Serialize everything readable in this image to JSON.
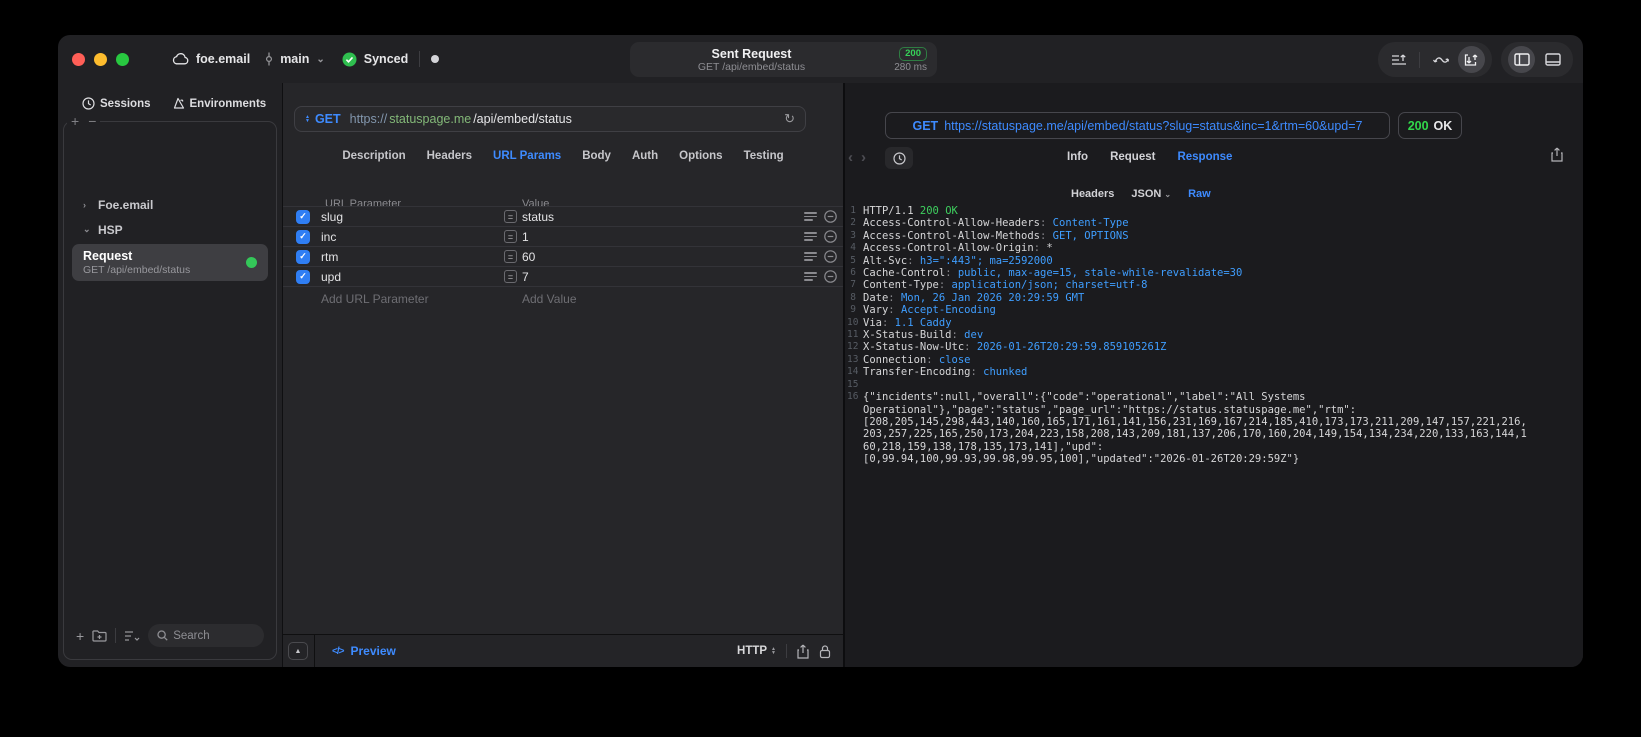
{
  "titlebar": {
    "project": "foe.email",
    "branch": "main",
    "sync_status": "Synced",
    "request_title": "Sent Request",
    "request_subtitle": "GET /api/embed/status",
    "status_code": "200",
    "duration": "280 ms"
  },
  "sidebar": {
    "tabs": [
      {
        "label": "Sessions"
      },
      {
        "label": "Environments"
      }
    ],
    "groups": [
      {
        "label": "Foe.email",
        "chevron": "›"
      },
      {
        "label": "HSP",
        "chevron": "⌄"
      }
    ],
    "request_item": {
      "title": "Request",
      "subtitle": "GET /api/embed/status"
    },
    "search_placeholder": "Search"
  },
  "request_editor": {
    "method": "GET",
    "url": {
      "scheme": "https://",
      "host": "statuspage.me",
      "path": "/api/embed/status"
    },
    "tabs": [
      "Description",
      "Headers",
      "URL Params",
      "Body",
      "Auth",
      "Options",
      "Testing"
    ],
    "active_tab": "URL Params",
    "params": {
      "name_header": "URL Parameter",
      "value_header": "Value",
      "rows": [
        {
          "name": "slug",
          "value": "status",
          "enabled": true
        },
        {
          "name": "inc",
          "value": "1",
          "enabled": true
        },
        {
          "name": "rtm",
          "value": "60",
          "enabled": true
        },
        {
          "name": "upd",
          "value": "7",
          "enabled": true
        }
      ],
      "add_name": "Add URL Parameter",
      "add_value": "Add Value",
      "check_glyph": "✓",
      "equals_glyph": "="
    },
    "footer": {
      "preview": "Preview",
      "code_glyph": "</>",
      "protocol": "HTTP",
      "collapse_glyph": "▲"
    }
  },
  "response_viewer": {
    "method": "GET",
    "request_url": "https://statuspage.me/api/embed/status?slug=status&inc=1&rtm=60&upd=7",
    "status_code": "200",
    "status_text": "OK",
    "nav": {
      "back": "‹",
      "forward": "›"
    },
    "tabs": [
      "Info",
      "Request",
      "Response"
    ],
    "active_tab": "Response",
    "view_tabs": [
      "Headers",
      "JSON",
      "Raw"
    ],
    "active_view_tab": "Raw",
    "accent_blue": "#3f9eff",
    "accent_green": "#3ecf5e",
    "code_lines": [
      {
        "n": "1",
        "parts": [
          {
            "t": "HTTP/1.1 ",
            "c": "plain"
          },
          {
            "t": "200 OK",
            "c": "green"
          }
        ]
      },
      {
        "n": "2",
        "parts": [
          {
            "t": "Access-Control-Allow-Headers",
            "c": "plain"
          },
          {
            "t": ": ",
            "c": "dim"
          },
          {
            "t": "Content-Type",
            "c": "blue"
          }
        ]
      },
      {
        "n": "3",
        "parts": [
          {
            "t": "Access-Control-Allow-Methods",
            "c": "plain"
          },
          {
            "t": ": ",
            "c": "dim"
          },
          {
            "t": "GET, OPTIONS",
            "c": "blue"
          }
        ]
      },
      {
        "n": "4",
        "parts": [
          {
            "t": "Access-Control-Allow-Origin",
            "c": "plain"
          },
          {
            "t": ": ",
            "c": "dim"
          },
          {
            "t": "*",
            "c": "plain"
          }
        ]
      },
      {
        "n": "5",
        "parts": [
          {
            "t": "Alt-Svc",
            "c": "plain"
          },
          {
            "t": ": ",
            "c": "dim"
          },
          {
            "t": "h3=\":443\"; ma=2592000",
            "c": "blue"
          }
        ]
      },
      {
        "n": "6",
        "parts": [
          {
            "t": "Cache-Control",
            "c": "plain"
          },
          {
            "t": ": ",
            "c": "dim"
          },
          {
            "t": "public, max-age=15, stale-while-revalidate=30",
            "c": "blue"
          }
        ]
      },
      {
        "n": "7",
        "parts": [
          {
            "t": "Content-Type",
            "c": "plain"
          },
          {
            "t": ": ",
            "c": "dim"
          },
          {
            "t": "application/json; charset=utf-8",
            "c": "blue"
          }
        ]
      },
      {
        "n": "8",
        "parts": [
          {
            "t": "Date",
            "c": "plain"
          },
          {
            "t": ": ",
            "c": "dim"
          },
          {
            "t": "Mon, 26 Jan 2026 20:29:59 GMT",
            "c": "blue"
          }
        ]
      },
      {
        "n": "9",
        "parts": [
          {
            "t": "Vary",
            "c": "plain"
          },
          {
            "t": ": ",
            "c": "dim"
          },
          {
            "t": "Accept-Encoding",
            "c": "blue"
          }
        ]
      },
      {
        "n": "10",
        "parts": [
          {
            "t": "Via",
            "c": "plain"
          },
          {
            "t": ": ",
            "c": "dim"
          },
          {
            "t": "1.1 Caddy",
            "c": "blue"
          }
        ]
      },
      {
        "n": "11",
        "parts": [
          {
            "t": "X-Status-Build",
            "c": "plain"
          },
          {
            "t": ": ",
            "c": "dim"
          },
          {
            "t": "dev",
            "c": "blue"
          }
        ]
      },
      {
        "n": "12",
        "parts": [
          {
            "t": "X-Status-Now-Utc",
            "c": "plain"
          },
          {
            "t": ": ",
            "c": "dim"
          },
          {
            "t": "2026-01-26T20:29:59.859105261Z",
            "c": "blue"
          }
        ]
      },
      {
        "n": "13",
        "parts": [
          {
            "t": "Connection",
            "c": "plain"
          },
          {
            "t": ": ",
            "c": "dim"
          },
          {
            "t": "close",
            "c": "blue"
          }
        ]
      },
      {
        "n": "14",
        "parts": [
          {
            "t": "Transfer-Encoding",
            "c": "plain"
          },
          {
            "t": ": ",
            "c": "dim"
          },
          {
            "t": "chunked",
            "c": "blue"
          }
        ]
      },
      {
        "n": "15",
        "parts": []
      },
      {
        "n": "16",
        "parts": [
          {
            "t": "{\"incidents\":null,\"overall\":{\"code\":\"operational\",\"label\":\"All Systems",
            "c": "plain"
          }
        ]
      },
      {
        "n": "",
        "parts": [
          {
            "t": "Operational\"},\"page\":\"status\",\"page_url\":\"https://status.statuspage.me\",\"rtm\":",
            "c": "plain"
          }
        ]
      },
      {
        "n": "",
        "parts": [
          {
            "t": "[208,205,145,298,443,140,160,165,171,161,141,156,231,169,167,214,185,410,173,173,211,209,147,157,221,216,",
            "c": "plain"
          }
        ]
      },
      {
        "n": "",
        "parts": [
          {
            "t": "203,257,225,165,250,173,204,223,158,208,143,209,181,137,206,170,160,204,149,154,134,234,220,133,163,144,1",
            "c": "plain"
          }
        ]
      },
      {
        "n": "",
        "parts": [
          {
            "t": "60,218,159,138,178,135,173,141],\"upd\":",
            "c": "plain"
          }
        ]
      },
      {
        "n": "",
        "parts": [
          {
            "t": "[0,99.94,100,99.93,99.98,99.95,100],\"updated\":\"2026-01-26T20:29:59Z\"}",
            "c": "plain"
          }
        ]
      }
    ]
  }
}
